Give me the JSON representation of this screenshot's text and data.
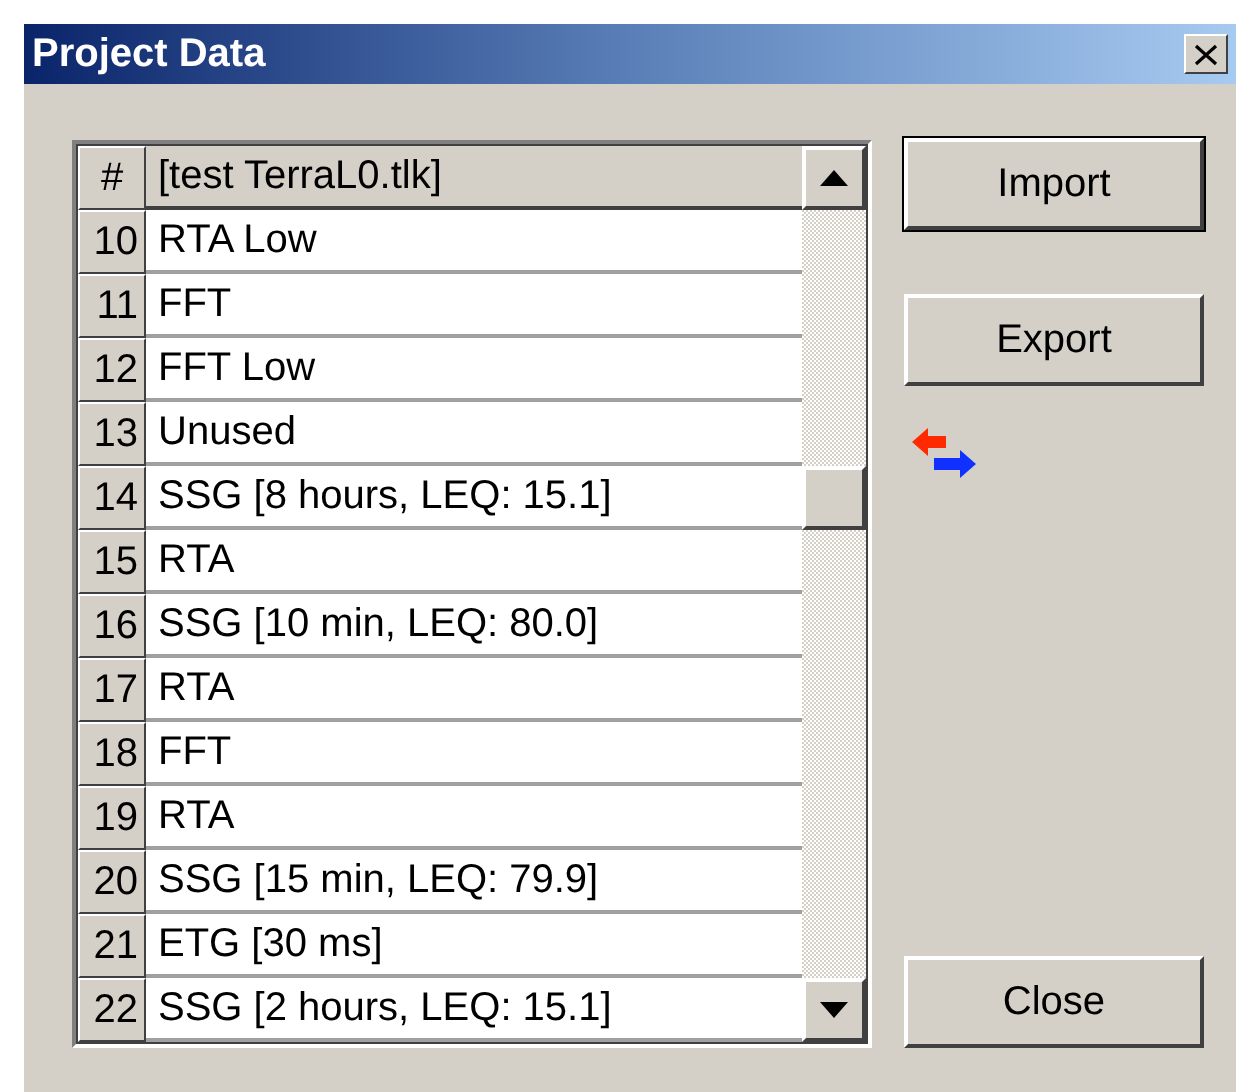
{
  "window": {
    "title": "Project Data"
  },
  "table": {
    "columns": [
      "#",
      "[test TerraL0.tlk]"
    ],
    "rows": [
      {
        "number": "10",
        "name": "RTA Low"
      },
      {
        "number": "11",
        "name": "FFT"
      },
      {
        "number": "12",
        "name": "FFT Low"
      },
      {
        "number": "13",
        "name": "Unused"
      },
      {
        "number": "14",
        "name": "SSG [8 hours, LEQ: 15.1]"
      },
      {
        "number": "15",
        "name": "RTA"
      },
      {
        "number": "16",
        "name": "SSG [10 min, LEQ: 80.0]"
      },
      {
        "number": "17",
        "name": "RTA"
      },
      {
        "number": "18",
        "name": "FFT"
      },
      {
        "number": "19",
        "name": "RTA"
      },
      {
        "number": "20",
        "name": "SSG [15 min, LEQ: 79.9]"
      },
      {
        "number": "21",
        "name": "ETG [30 ms]"
      },
      {
        "number": "22",
        "name": "SSG [2 hours, LEQ: 15.1]"
      }
    ]
  },
  "buttons": {
    "import": "Import",
    "export": "Export",
    "close": "Close"
  }
}
